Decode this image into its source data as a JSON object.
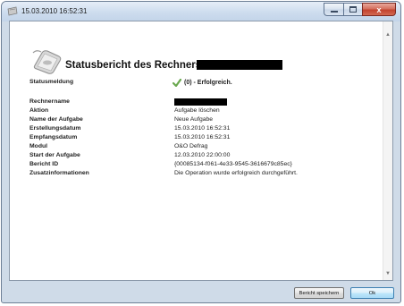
{
  "window": {
    "title": "15.03.2010 16:52:31",
    "close_glyph": "x"
  },
  "report": {
    "heading": "Statusbericht des Rechners",
    "status_label": "Statusmeldung",
    "status_value": "(0) - Erfolgreich.",
    "fields": [
      {
        "label": "Rechnername",
        "value": ""
      },
      {
        "label": "Aktion",
        "value": "Aufgabe löschen"
      },
      {
        "label": "Name der Aufgabe",
        "value": "Neue Aufgabe"
      },
      {
        "label": "Erstellungsdatum",
        "value": "15.03.2010 16:52:31"
      },
      {
        "label": "Empfangsdatum",
        "value": "15.03.2010 16:52:31"
      },
      {
        "label": "Modul",
        "value": "O&O Defrag"
      },
      {
        "label": "Start der Aufgabe",
        "value": "12.03.2010 22:00:00"
      },
      {
        "label": "Bericht ID",
        "value": "{00085134-f061-4e33-9545-3616679c85ec}"
      },
      {
        "label": "Zusatzinformationen",
        "value": "Die Operation wurde erfolgreich durchgeführt."
      }
    ]
  },
  "buttons": {
    "save": "Bericht speichern",
    "ok": "Ok"
  },
  "icons": {
    "title": "app-icon",
    "logo": "computer-mouse-icon",
    "status": "checkmark-icon"
  },
  "colors": {
    "check": "#6aa84f",
    "redaction": "#000000"
  }
}
